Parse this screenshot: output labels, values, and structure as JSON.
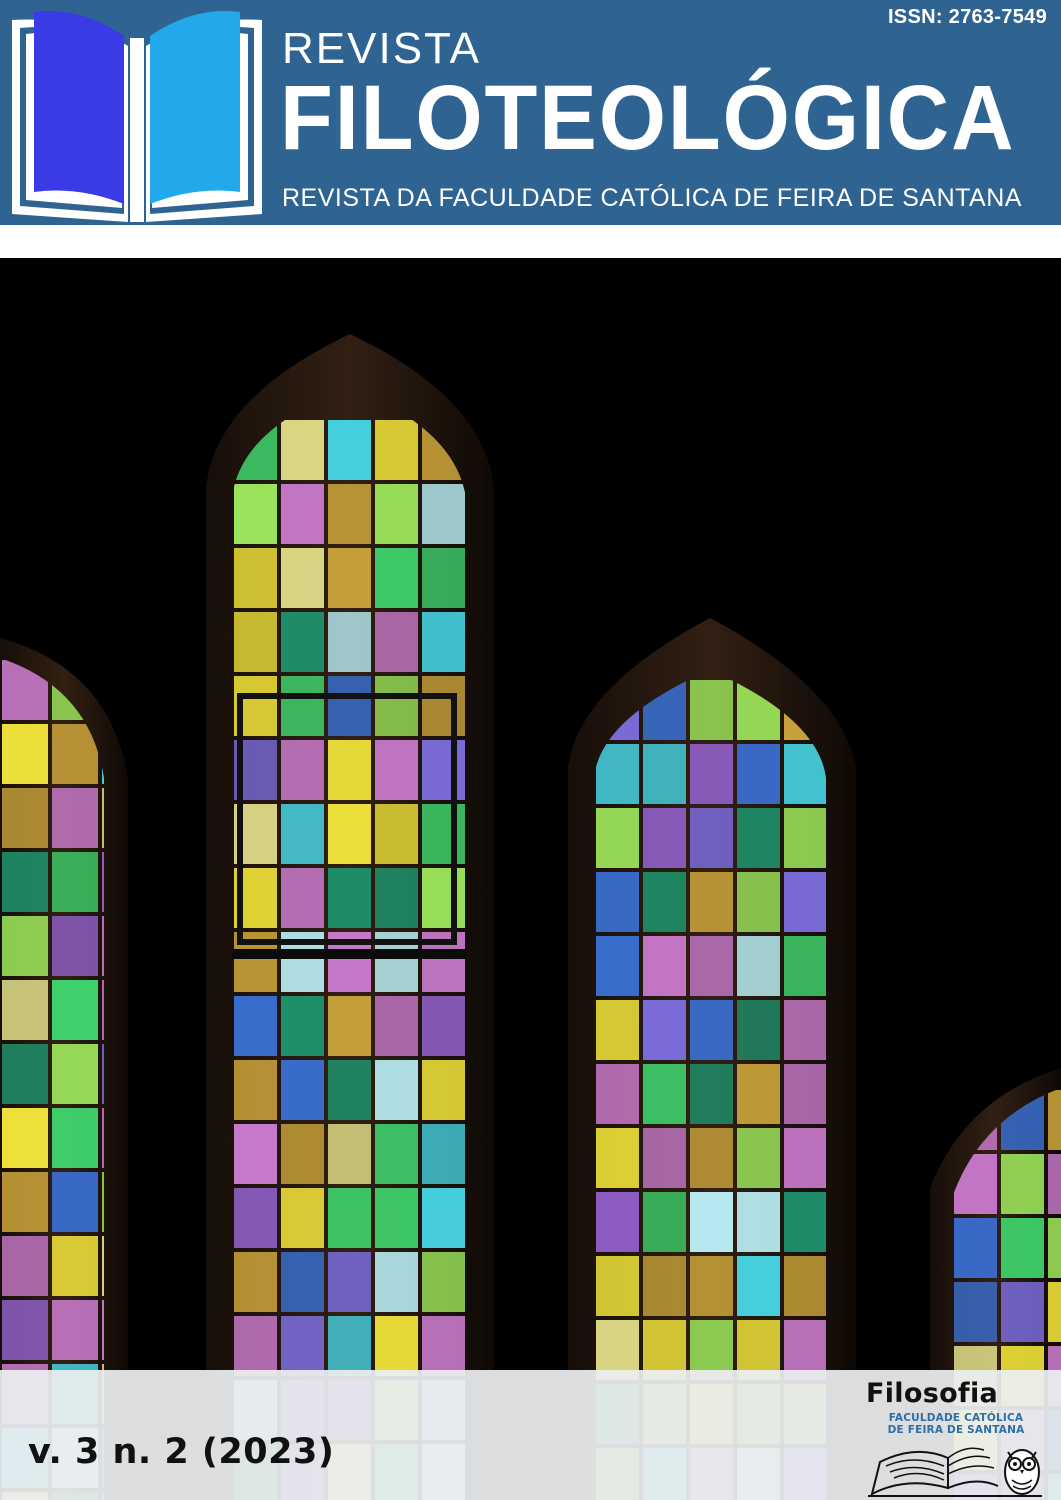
{
  "header": {
    "issn": "ISSN: 2763-7549",
    "revista_word": "REVISTA",
    "title": "FILOTEOLÓGICA",
    "subtitle": "REVISTA DA FACULDADE CATÓLICA DE FEIRA DE SANTANA",
    "logo_icon": "open-book-icon"
  },
  "cover_image": {
    "icon": "stained-glass-windows-image",
    "palette": [
      "#f0e33a",
      "#9be35a",
      "#3fd06b",
      "#46d1e0",
      "#7a6bd8",
      "#c779c9",
      "#1f8f6a",
      "#c9a23a",
      "#e3e08a",
      "#3a6fd0",
      "#b6e9ef",
      "#8f5fc6"
    ]
  },
  "footer": {
    "volume": "v. 3 n. 2 (2023)",
    "dept_name": "Filosofia",
    "dept_line1": "FACULDADE CATÓLICA",
    "dept_line2": "DE FEIRA DE SANTANA",
    "dept_icon": "owl-book-icon"
  },
  "colors": {
    "header_bg": "#2f6492",
    "accent_blue": "#2f6ea5",
    "footer_band": "#eceef0"
  }
}
